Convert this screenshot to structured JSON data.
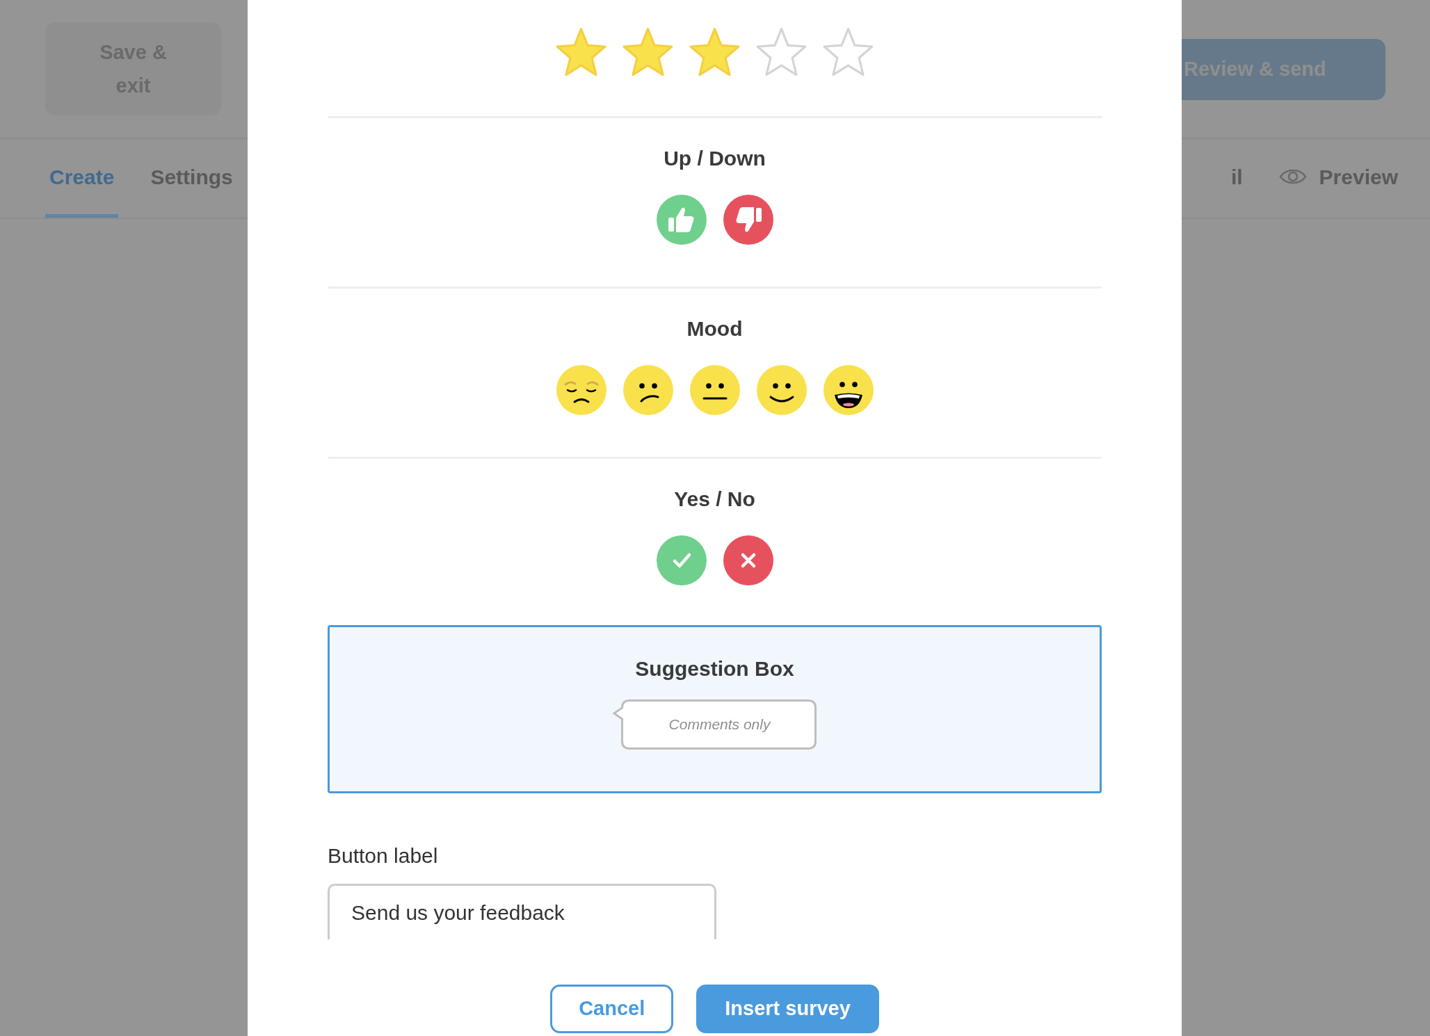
{
  "header": {
    "save_button": "Save & exit",
    "review_button": "Review & send"
  },
  "tabs_left": [
    {
      "label": "Create",
      "selected": true
    },
    {
      "label": "Settings",
      "selected": false
    }
  ],
  "tabs_right": [
    {
      "label": "il",
      "selected": false,
      "kind": "plain"
    },
    {
      "label": "Preview",
      "selected": false,
      "kind": "preview"
    }
  ],
  "modal": {
    "rating": {
      "stars": 3
    },
    "sections": [
      {
        "kind": "updown",
        "title": "Up / Down"
      },
      {
        "kind": "mood",
        "title": "Mood"
      },
      {
        "kind": "yesno",
        "title": "Yes / No"
      },
      {
        "kind": "suggestion",
        "title": "Suggestion Box",
        "selected": true,
        "hint": "Comments only"
      }
    ],
    "button_label": {
      "label": "Button label",
      "value": "Send us your feedback"
    },
    "buttons": [
      {
        "label": "Cancel",
        "kind": "outline"
      },
      {
        "label": "Insert survey",
        "kind": "primary"
      }
    ]
  }
}
